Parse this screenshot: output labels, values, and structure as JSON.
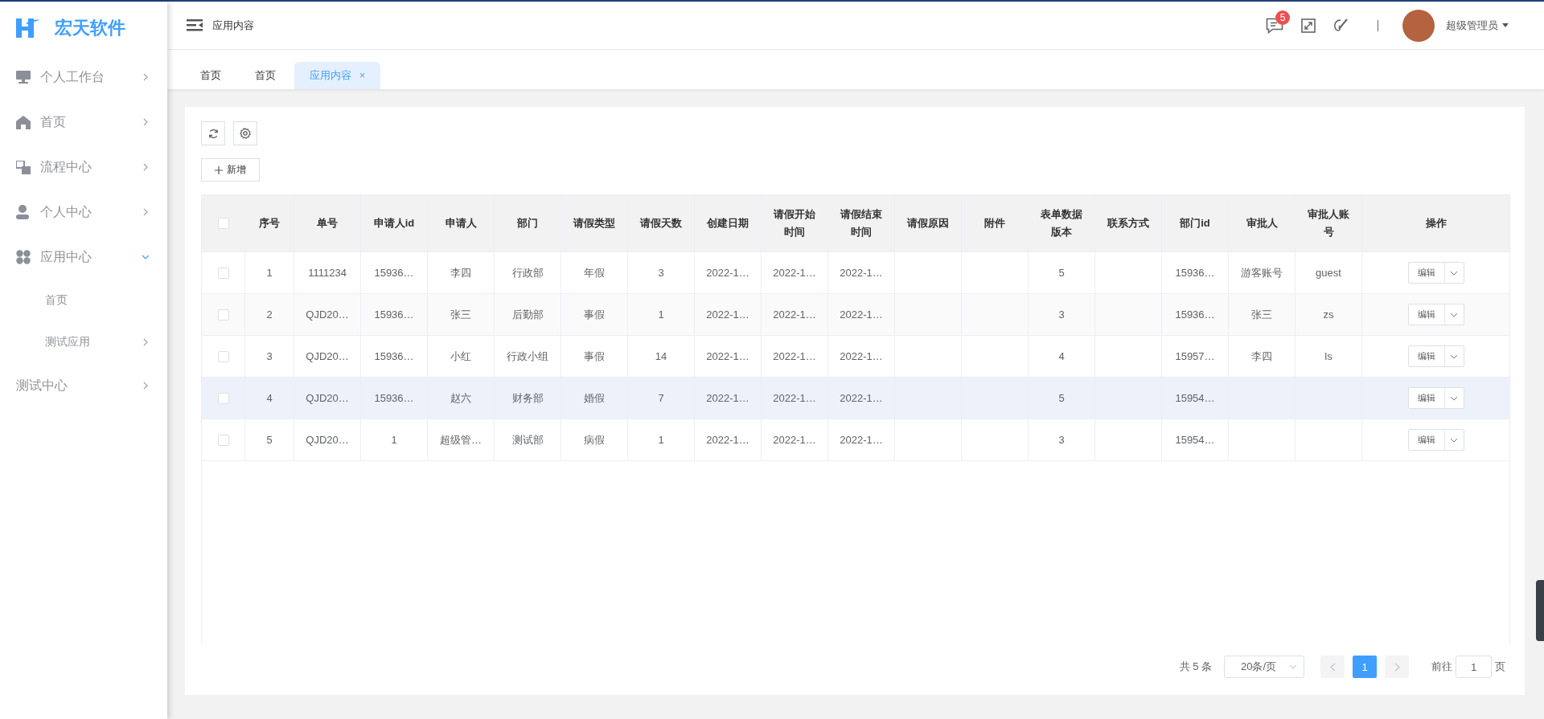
{
  "brand": {
    "name": "宏天软件"
  },
  "sidebar": {
    "items": [
      {
        "label": "个人工作台",
        "expanded": false
      },
      {
        "label": "首页",
        "expanded": false
      },
      {
        "label": "流程中心",
        "expanded": false
      },
      {
        "label": "个人中心",
        "expanded": false
      },
      {
        "label": "应用中心",
        "expanded": true,
        "children": [
          {
            "label": "首页"
          },
          {
            "label": "测试应用",
            "expanded": false
          }
        ]
      },
      {
        "label": "测试中心",
        "expanded": false
      }
    ]
  },
  "header": {
    "title": "应用内容",
    "message_badge": "5",
    "user_name": "超级管理员"
  },
  "tabs": [
    {
      "label": "首页",
      "selected": false,
      "closable": false
    },
    {
      "label": "首页",
      "selected": false,
      "closable": false
    },
    {
      "label": "应用内容",
      "selected": true,
      "closable": true,
      "close": "×"
    }
  ],
  "toolbar": {
    "add_button": "新增"
  },
  "table": {
    "select_all_checked": false,
    "columns": [
      "序号",
      "单号",
      "申请人id",
      "申请人",
      "部门",
      "请假类型",
      "请假天数",
      "创建日期",
      "请假开始时间",
      "请假结束时间",
      "请假原因",
      "附件",
      "表单数据版本",
      "联系方式",
      "部门id",
      "审批人",
      "审批人账号",
      "操作"
    ],
    "rows": [
      {
        "checked": false,
        "highlighted": false,
        "cells": [
          "1",
          "1111234",
          "15936…",
          "李四",
          "行政部",
          "年假",
          "3",
          "2022-1…",
          "2022-1…",
          "2022-1…",
          null,
          null,
          "5",
          null,
          "15936…",
          "游客账号",
          "guest"
        ],
        "action": "编辑"
      },
      {
        "checked": false,
        "highlighted": false,
        "cells": [
          "2",
          "QJD20…",
          "15936…",
          "张三",
          "后勤部",
          "事假",
          "1",
          "2022-1…",
          "2022-1…",
          "2022-1…",
          null,
          null,
          "3",
          null,
          "15936…",
          "张三",
          "zs"
        ],
        "action": "编辑"
      },
      {
        "checked": false,
        "highlighted": false,
        "cells": [
          "3",
          "QJD20…",
          "15936…",
          "小红",
          "行政小组",
          "事假",
          "14",
          "2022-1…",
          "2022-1…",
          "2022-1…",
          null,
          null,
          "4",
          null,
          "15957…",
          "李四",
          "ls"
        ],
        "action": "编辑"
      },
      {
        "checked": false,
        "highlighted": true,
        "cells": [
          "4",
          "QJD20…",
          "15936…",
          "赵六",
          "财务部",
          "婚假",
          "7",
          "2022-1…",
          "2022-1…",
          "2022-1…",
          null,
          null,
          "5",
          null,
          "15954…",
          null,
          null
        ],
        "action": "编辑"
      },
      {
        "checked": false,
        "highlighted": false,
        "cells": [
          "5",
          "QJD20…",
          "1",
          "超级管…",
          "测试部",
          "病假",
          "1",
          "2022-1…",
          "2022-1…",
          "2022-1…",
          null,
          null,
          "3",
          null,
          "15954…",
          null,
          null
        ],
        "action": "编辑"
      }
    ]
  },
  "pagination": {
    "total": "共 5 条",
    "page_size": "20条/页",
    "pages": [
      {
        "label": "1",
        "selected": true
      }
    ],
    "goto_label": "前往",
    "goto_value": "1",
    "page_unit": "页"
  }
}
